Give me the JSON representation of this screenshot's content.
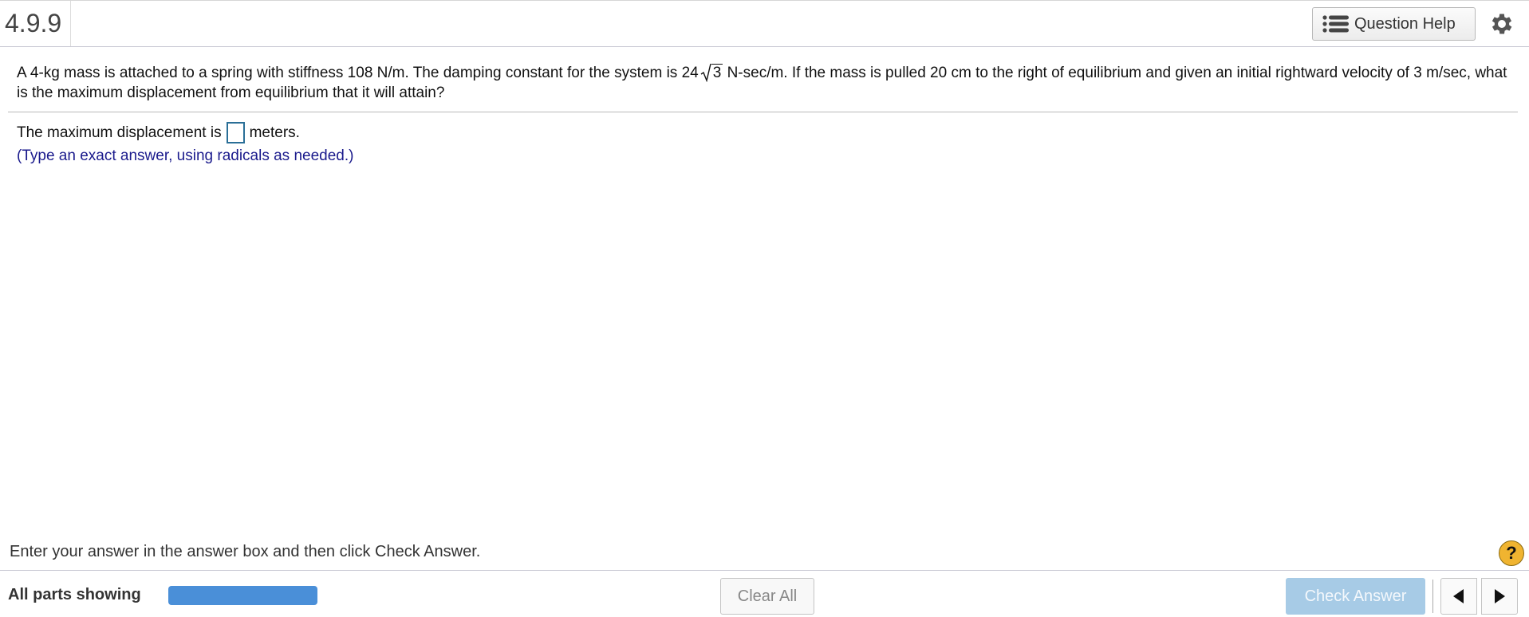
{
  "header": {
    "question_number": "4.9.9",
    "help_label": "Question Help"
  },
  "question": {
    "text_part1": "A 4-kg mass is attached to a spring with stiffness 108 N/m. The damping constant for the system is 24",
    "radicand": "3",
    "text_part2": " N-sec/m. If the mass is pulled 20 cm to the right of equilibrium and given an initial rightward velocity of 3 m/sec, what is the maximum displacement from equilibrium that it will attain?"
  },
  "answer": {
    "prefix": "The maximum displacement is",
    "suffix": "meters.",
    "hint": "(Type an exact answer, using radicals as needed.)"
  },
  "footer": {
    "instruction": "Enter your answer in the answer box and then click Check Answer.",
    "help_symbol": "?",
    "parts_label": "All parts showing",
    "progress_fraction": 1.0,
    "clear_label": "Clear All",
    "check_label": "Check Answer"
  },
  "colors": {
    "progress": "#4a8fd8",
    "check_button": "#a7cbe6",
    "hint_text": "#1a1a8c",
    "help_badge": "#f0b430",
    "answer_box_border": "#2a6f97"
  }
}
